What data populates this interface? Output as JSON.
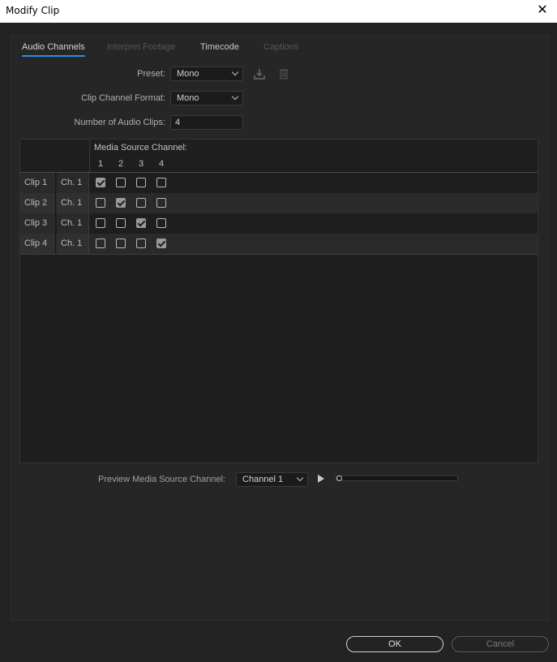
{
  "window": {
    "title": "Modify Clip",
    "close_glyph": "✕"
  },
  "tabs": [
    {
      "label": "Audio Channels",
      "state": "active"
    },
    {
      "label": "Interpret Footage",
      "state": "disabled"
    },
    {
      "label": "Timecode",
      "state": "enabled"
    },
    {
      "label": "Captions",
      "state": "disabled"
    }
  ],
  "form": {
    "preset_label": "Preset:",
    "preset_value": "Mono",
    "format_label": "Clip Channel Format:",
    "format_value": "Mono",
    "clips_label": "Number of Audio Clips:",
    "clips_value": "4",
    "icons": [
      "save-preset-icon",
      "delete-preset-icon"
    ]
  },
  "grid": {
    "header": "Media Source Channel:",
    "columns": [
      "1",
      "2",
      "3",
      "4"
    ],
    "rows": [
      {
        "clip": "Clip 1",
        "channel": "Ch. 1",
        "checked": [
          true,
          false,
          false,
          false
        ]
      },
      {
        "clip": "Clip 2",
        "channel": "Ch. 1",
        "checked": [
          false,
          true,
          false,
          false
        ]
      },
      {
        "clip": "Clip 3",
        "channel": "Ch. 1",
        "checked": [
          false,
          false,
          true,
          false
        ]
      },
      {
        "clip": "Clip 4",
        "channel": "Ch. 1",
        "checked": [
          false,
          false,
          false,
          true
        ]
      }
    ]
  },
  "preview": {
    "label": "Preview Media Source Channel:",
    "channel_value": "Channel 1",
    "playhead_fraction": 0
  },
  "buttons": {
    "ok": "OK",
    "cancel": "Cancel"
  },
  "colors": {
    "accent": "#2d8ceb",
    "background": "#232323"
  }
}
